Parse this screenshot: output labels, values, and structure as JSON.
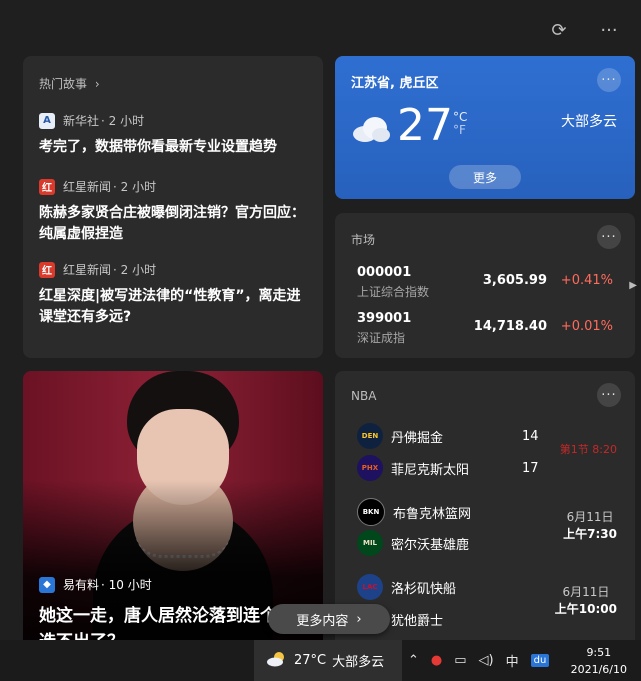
{
  "hot_stories": {
    "title": "热门故事",
    "chevron": "›",
    "items": [
      {
        "source": "新华社",
        "time": "· 2 小时",
        "title": "考完了，数据带你看最新专业设置趋势",
        "icon": "xinhua-icon"
      },
      {
        "source": "红星新闻",
        "time": "· 2 小时",
        "title": "陈赫多家贤合庄被曝倒闭注销？官方回应：纯属虚假捏造",
        "icon": "hongxing-icon"
      },
      {
        "source": "红星新闻",
        "time": "· 2 小时",
        "title": "红星深度|被写进法律的“性教育”，离走进课堂还有多远?",
        "icon": "hongxing-icon"
      }
    ]
  },
  "weather": {
    "location": "江苏省, 虎丘区",
    "temp": "27",
    "unit_c": "°C",
    "unit_f": "°F",
    "condition": "大部多云",
    "more": "更多",
    "icon": "partly-cloudy-icon"
  },
  "market": {
    "title": "市场",
    "rows": [
      {
        "code": "000001",
        "name": "上证综合指数",
        "price": "3,605.99",
        "change": "+0.41%"
      },
      {
        "code": "399001",
        "name": "深证成指",
        "price": "14,718.40",
        "change": "+0.01%"
      }
    ]
  },
  "feature": {
    "source": "易有料",
    "time": "· 10 小时",
    "title": "她这一走，唐人居然沦落到连个新剧都选不出了？"
  },
  "nba": {
    "title": "NBA",
    "games": [
      {
        "team1": "丹佛掘金",
        "team2": "菲尼克斯太阳",
        "score1": "14",
        "score2": "17",
        "status": "第1节 8:20"
      },
      {
        "team1": "布鲁克林篮网",
        "team2": "密尔沃基雄鹿",
        "date": "6月11日",
        "time": "上午7:30"
      },
      {
        "team1": "洛杉矶快船",
        "team2": "犹他爵士",
        "date": "6月11日",
        "time": "上午10:00"
      }
    ]
  },
  "more_content": "更多内容",
  "taskbar": {
    "temp": "27°C",
    "condition": "大部多云",
    "ime": "中",
    "clock_time": "9:51",
    "clock_date": "2021/6/10"
  },
  "colors": {
    "accent": "#2f6fd1",
    "positive": "#ff6b5c",
    "live": "#c62828"
  }
}
